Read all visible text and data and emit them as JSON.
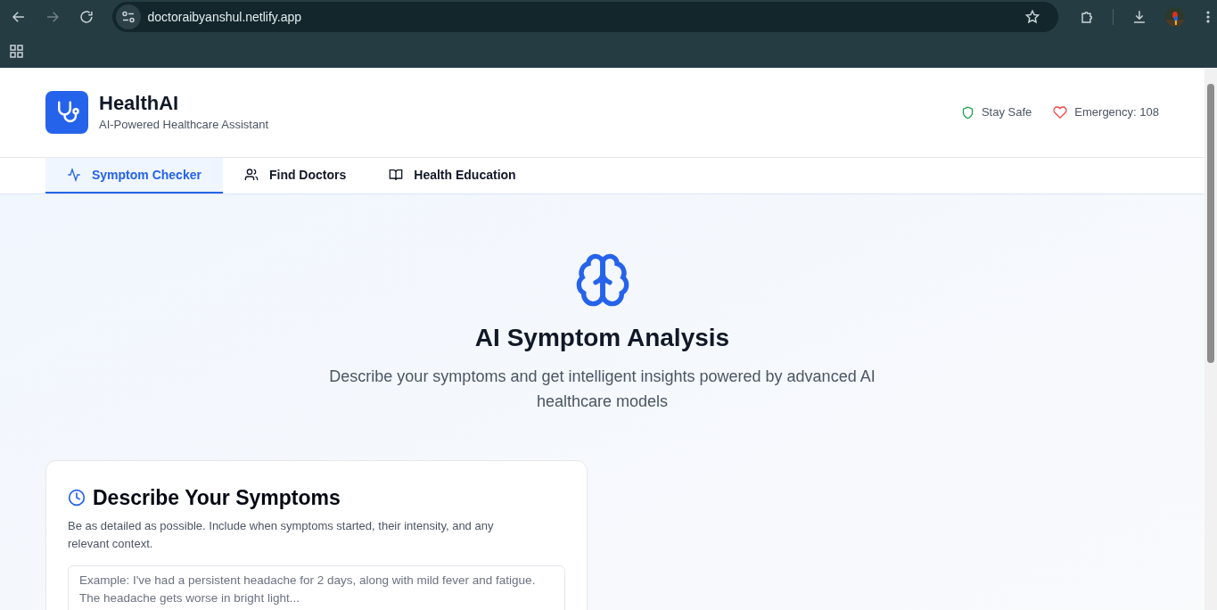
{
  "browser": {
    "url": "doctoraibyanshul.netlify.app"
  },
  "header": {
    "app_name": "HealthAI",
    "tagline": "AI-Powered Healthcare Assistant",
    "badges": [
      {
        "kind": "shield",
        "label": "Stay Safe"
      },
      {
        "kind": "heart",
        "label": "Emergency: 108"
      }
    ]
  },
  "tabs": [
    {
      "kind": "activity",
      "label": "Symptom Checker",
      "selected": true
    },
    {
      "kind": "users",
      "label": "Find Doctors",
      "selected": false
    },
    {
      "kind": "book",
      "label": "Health Education",
      "selected": false
    }
  ],
  "hero": {
    "title": "AI Symptom Analysis",
    "subtitle": "Describe your symptoms and get intelligent insights powered by advanced AI healthcare models"
  },
  "card": {
    "title": "Describe Your Symptoms",
    "description": "Be as detailed as possible. Include when symptoms started, their intensity, and any relevant context.",
    "placeholder": "Example: I've had a persistent headache for 2 days, along with mild fever and fatigue. The headache gets worse in bright light..."
  }
}
